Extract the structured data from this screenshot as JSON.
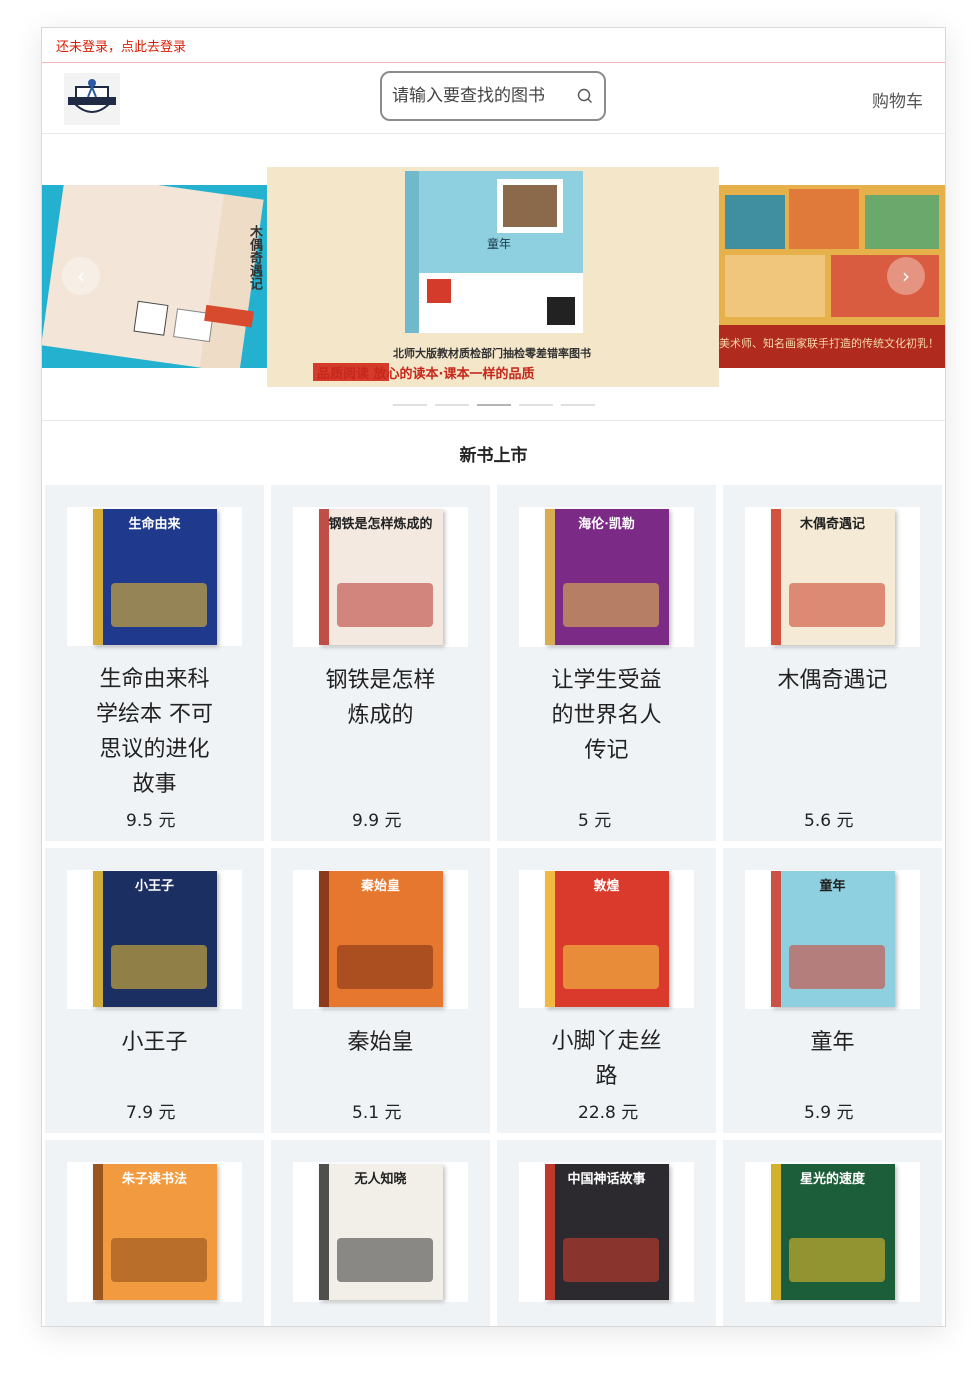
{
  "login": {
    "text": "还未登录，点此去登录"
  },
  "header": {
    "search_placeholder": "请输入要查找的图书",
    "cart_label": "购物车"
  },
  "carousel": {
    "slides": [
      {
        "caption": "木偶奇遇记"
      },
      {
        "caption": "童年",
        "tagline_top": "北师大版教材质检部门抽检零差错率图书",
        "tagline_bottom": "品质阅读 放心的读本·课本一样的品质"
      },
      {
        "caption": "美术师、知名画家联手打造的传统文化初乳！"
      }
    ],
    "active_index": 2,
    "count": 5
  },
  "section": {
    "title": "新书上市"
  },
  "books": [
    {
      "title": "生命由来科学绘本 不可思议的进化故事",
      "price": "9.5 元",
      "cover_text": "生命由来",
      "cover_color": "#1f3a8c",
      "accent": "#f6c12a"
    },
    {
      "title": "钢铁是怎样炼成的",
      "price": "9.9 元",
      "cover_text": "钢铁是怎样炼成的",
      "cover_color": "#f3e9e1",
      "accent": "#b5332b"
    },
    {
      "title": "让学生受益的世界名人传记",
      "price": "5 元",
      "cover_text": "海伦·凯勒",
      "cover_color": "#7b2a86",
      "accent": "#e8c34a"
    },
    {
      "title": "木偶奇遇记",
      "price": "5.6 元",
      "cover_text": "木偶奇遇记",
      "cover_color": "#f4ead5",
      "accent": "#c93a24"
    },
    {
      "title": "小王子",
      "price": "7.9 元",
      "cover_text": "小王子",
      "cover_color": "#1b2f63",
      "accent": "#f1c232"
    },
    {
      "title": "秦始皇",
      "price": "5.1 元",
      "cover_text": "秦始皇",
      "cover_color": "#e6772e",
      "accent": "#7a2f17"
    },
    {
      "title": "小脚丫走丝路",
      "price": "22.8 元",
      "cover_text": "敦煌",
      "cover_color": "#d93a2b",
      "accent": "#f6d046"
    },
    {
      "title": "童年",
      "price": "5.9 元",
      "cover_text": "童年",
      "cover_color": "#8fd0e0",
      "accent": "#d43b2a"
    },
    {
      "title": "",
      "price": "",
      "cover_text": "朱子读书法",
      "cover_color": "#f29a3f",
      "accent": "#8a4a1a"
    },
    {
      "title": "",
      "price": "",
      "cover_text": "无人知晓",
      "cover_color": "#f2efe9",
      "accent": "#333333"
    },
    {
      "title": "",
      "price": "",
      "cover_text": "中国神话故事",
      "cover_color": "#2d2a2f",
      "accent": "#d63c2b"
    },
    {
      "title": "",
      "price": "",
      "cover_text": "星光的速度",
      "cover_color": "#1d5e3a",
      "accent": "#f2c12b"
    }
  ]
}
